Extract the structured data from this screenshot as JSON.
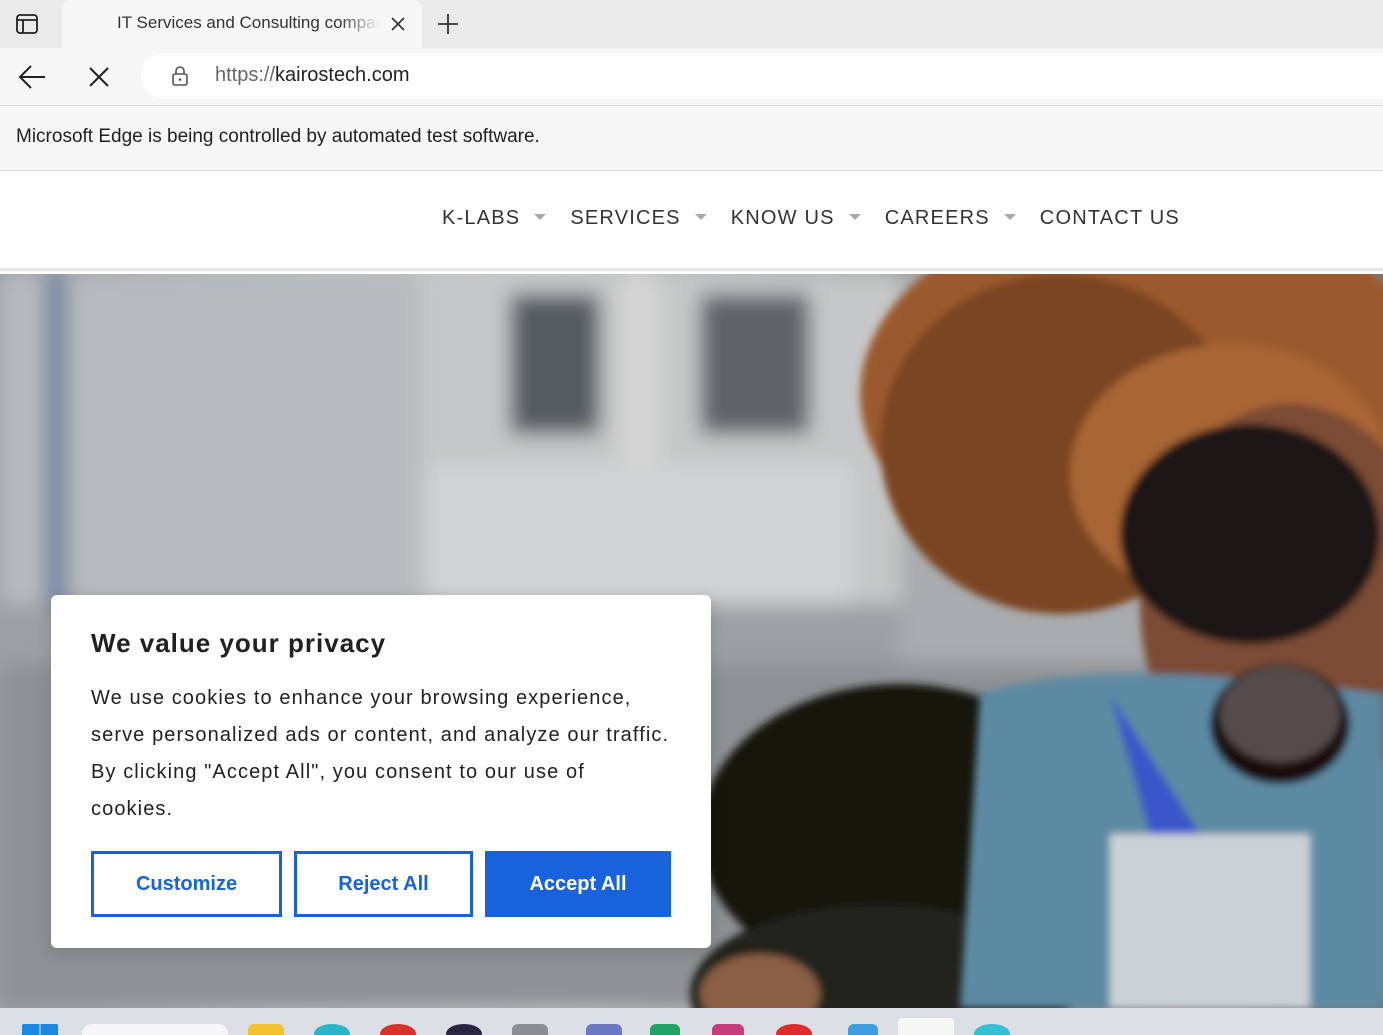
{
  "browser": {
    "tab": {
      "title": "IT Services and Consulting company"
    },
    "address": {
      "scheme": "https://",
      "host": "kairostech.com"
    },
    "infobar": {
      "message": "Microsoft Edge is being controlled by automated test software."
    }
  },
  "site": {
    "nav": {
      "items": [
        {
          "label": "K-LABS",
          "has_dropdown": true
        },
        {
          "label": "SERVICES",
          "has_dropdown": true
        },
        {
          "label": "KNOW US",
          "has_dropdown": true
        },
        {
          "label": "CAREERS",
          "has_dropdown": true
        },
        {
          "label": "CONTACT US",
          "has_dropdown": false
        }
      ]
    },
    "cookie_banner": {
      "title": "We value your privacy",
      "body": "We use cookies to enhance your browsing experience, serve personalized ads or content, and analyze our traffic. By clicking \"Accept All\", you consent to our use of cookies.",
      "customize_label": "Customize",
      "reject_label": "Reject All",
      "accept_label": "Accept All"
    }
  },
  "colors": {
    "accent": "#1863dc",
    "nav_text": "#333333"
  },
  "taskbar": {
    "icons": [
      "windows-start-icon",
      "search-box",
      "file-explorer-icon",
      "edge-icon",
      "app-icon",
      "app-icon",
      "app-icon",
      "app-icon",
      "app-icon",
      "app-icon",
      "app-icon",
      "app-icon",
      "app-icon",
      "app-icon"
    ]
  }
}
